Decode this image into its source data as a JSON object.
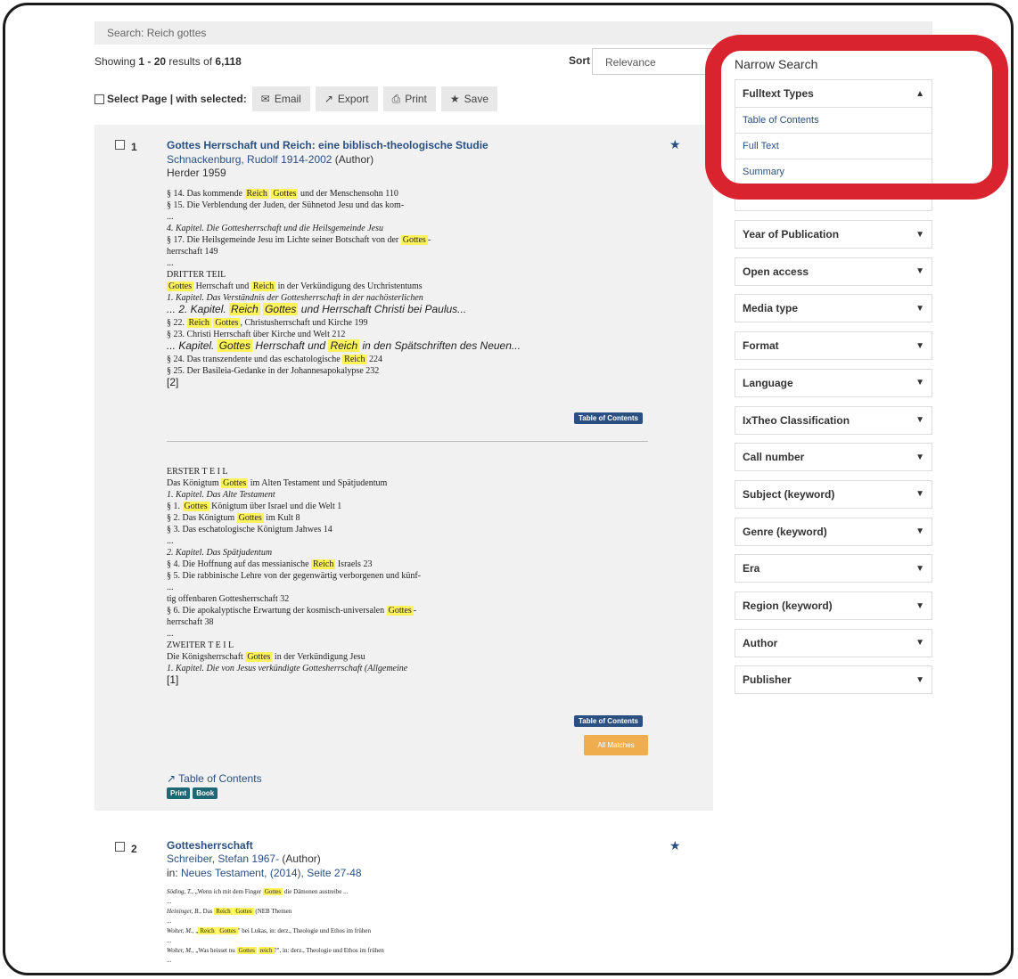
{
  "search": {
    "text": "Search: Reich gottes"
  },
  "results_info": {
    "prefix": "Showing ",
    "range": "1 - 20",
    "mid": " results of ",
    "total": "6,118"
  },
  "sort": {
    "label": "Sort",
    "value": "Relevance"
  },
  "actions": {
    "select_label": "Select Page | with selected:",
    "email": "Email",
    "export": "Export",
    "print": "Print",
    "save": "Save"
  },
  "result1": {
    "num": "1",
    "title": "Gottes Herrschaft und Reich: eine biblisch-theologische Studie",
    "author": "Schnackenburg, Rudolf 1914-2002",
    "author_role": " (Author)",
    "publisher": "Herder 1959",
    "toc_badge": "Table of Contents",
    "all_matches": "All Matches",
    "toc_link": "Table of Contents",
    "formats": [
      "Print",
      "Book"
    ],
    "snippet1": [
      {
        "pre": "§ 14. Das kommende ",
        "h1": "Reich",
        "mid": " ",
        "h2": "Gottes",
        "post": " und der Menschensohn 110",
        "style": ""
      },
      {
        "pre": "§ 15. Die Verblendung der Juden, der Sühnetod Jesu und das kom-",
        "style": ""
      },
      {
        "pre": "...",
        "style": ""
      },
      {
        "pre": "4. Kapitel. Die Gottesherrschaft und die Heilsgemeinde Jesu",
        "style": "i"
      },
      {
        "pre": "§ 17. Die Heilsgemeinde Jesu im Lichte seiner Botschaft von der ",
        "h1": "Gottes",
        "post": "-",
        "style": ""
      },
      {
        "pre": "herrschaft 149",
        "style": ""
      },
      {
        "pre": "...",
        "style": ""
      },
      {
        "pre": "DRITTER TEIL",
        "style": ""
      },
      {
        "pre": "",
        "h1": "Gottes",
        "mid": " Herrschaft und ",
        "h2": "Reich",
        "post": " in der Verkündigung des Urchristentums",
        "style": ""
      },
      {
        "pre": "1. Kapitel. Das Verständnis der Gottesherrschaft in der nachösterlichen",
        "style": "i"
      },
      {
        "pre": "... 2. Kapitel. ",
        "h1": "Reich",
        "mid": " ",
        "h2": "Gottes",
        "post": " und Herrschaft Christi bei Paulus...",
        "style": "sans"
      },
      {
        "pre": "§ 22. ",
        "h1": "Reich",
        "mid": " ",
        "h2": "Gottes",
        "post": ", Christusherrschaft und Kirche 199",
        "style": ""
      },
      {
        "pre": "§ 23. Christi Herrschaft über Kirche und Welt 212",
        "style": ""
      },
      {
        "pre": "... Kapitel. ",
        "h1": "Gottes",
        "mid": " Herrschaft und ",
        "h2": "Reich",
        "post": " in den Spätschriften des Neuen...",
        "style": "sans"
      },
      {
        "pre": "§ 24. Das transzendente und das eschatologische ",
        "h1": "Reich",
        "post": " 224",
        "style": ""
      },
      {
        "pre": "§ 25. Der Basileia-Gedanke in der Johannesapokalypse 232",
        "style": ""
      },
      {
        "pre": "[2]",
        "style": "num"
      }
    ],
    "snippet2": [
      {
        "pre": "ERSTER  T E I L",
        "style": ""
      },
      {
        "pre": "Das Königtum ",
        "h1": "Gottes",
        "post": " im Alten Testament und Spätjudentum",
        "style": ""
      },
      {
        "pre": "1. Kapitel. Das Alte Testament",
        "style": "i"
      },
      {
        "pre": "§ 1. ",
        "h1": "Gottes",
        "post": " Königtum über Israel und die Welt 1",
        "style": ""
      },
      {
        "pre": "§ 2. Das Königtum ",
        "h1": "Gottes",
        "post": " im Kult 8",
        "style": ""
      },
      {
        "pre": "§ 3. Das eschatologische Königtum Jahwes 14",
        "style": ""
      },
      {
        "pre": "...",
        "style": ""
      },
      {
        "pre": "2. Kapitel. Das Spätjudentum",
        "style": "i"
      },
      {
        "pre": "§ 4. Die Hoffnung auf das messianische ",
        "h1": "Reich",
        "post": " Israels 23",
        "style": ""
      },
      {
        "pre": "§ 5. Die rabbinische Lehre von der gegenwärtig verborgenen und künf-",
        "style": ""
      },
      {
        "pre": "...",
        "style": ""
      },
      {
        "pre": "tig offenbaren Gottesherrschaft 32",
        "style": ""
      },
      {
        "pre": "§ 6. Die apokalyptische Erwartung der kosmisch-universalen ",
        "h1": "Gottes",
        "post": "-",
        "style": ""
      },
      {
        "pre": "herrschaft 38",
        "style": ""
      },
      {
        "pre": "...",
        "style": ""
      },
      {
        "pre": "ZWEITER  T E I L",
        "style": ""
      },
      {
        "pre": "Die Königsherrschaft ",
        "h1": "Gottes",
        "post": " in der Verkündigung Jesu",
        "style": ""
      },
      {
        "pre": "1. Kapitel. Die von Jesus verkündigte Gottesherrschaft (Allgemeine",
        "style": "i"
      },
      {
        "pre": "[1]",
        "style": "num"
      }
    ]
  },
  "result2": {
    "num": "2",
    "title": "Gottesherrschaft",
    "author": "Schreiber, Stefan 1967-",
    "author_role": " (Author)",
    "in_label": "in: ",
    "in_link": "Neues Testament, (2014), Seite 27-48",
    "snippet": [
      {
        "it": "Söding, T.,",
        "pre": " „Wenn ich mit dem Finger ",
        "h1": "Gottes",
        "post": " die  Dämonen austreibe ..."
      },
      {
        "pre": "..."
      },
      {
        "it": "Heininger, B.,",
        "pre": " Das ",
        "h1": "Reich",
        "mid": " ",
        "h2": "Gottes",
        "post": " (NEB Themen"
      },
      {
        "pre": "..."
      },
      {
        "it": "Wolter, M.,",
        "pre": " „",
        "h1": "Reich",
        "mid": " ",
        "h2": "Gottes",
        "post": "\" bei Lukas, in: derz., Theologie und Ethos im frühen"
      },
      {
        "pre": "..."
      },
      {
        "it": "Wolter, M.,",
        "pre": " „Was heisset nu ",
        "h1": "Gottes",
        "mid": " ",
        "h2": "reich",
        "post": "?\", in: derz., Theologie und Ethos im frühen"
      },
      {
        "pre": "..."
      }
    ]
  },
  "sidebar": {
    "title": "Narrow Search",
    "fulltext": {
      "label": "Fulltext Types",
      "items": [
        "Table of Contents",
        "Full Text",
        "Summary"
      ]
    },
    "facets": [
      "Year of Publication",
      "Open access",
      "Media type",
      "Format",
      "Language",
      "IxTheo Classification",
      "Call number",
      "Subject (keyword)",
      "Genre (keyword)",
      "Era",
      "Region (keyword)",
      "Author",
      "Publisher"
    ]
  },
  "colors": {
    "link": "#2a5082",
    "highlight": "#fff25a",
    "annotation_ring": "#d9232e",
    "all_matches": "#f0ad4e",
    "format_badge": "#1d6875"
  }
}
